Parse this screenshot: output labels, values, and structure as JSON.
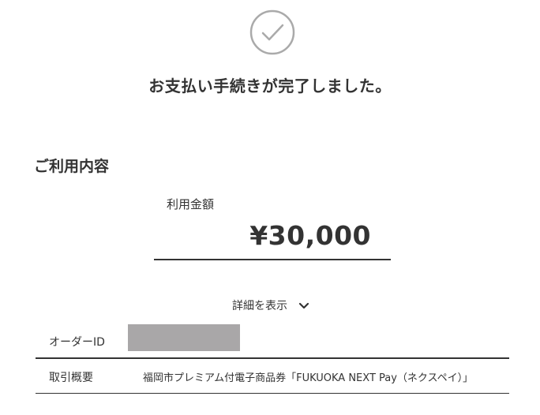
{
  "header": {
    "icon": "check-circle-icon",
    "title": "お支払い手続きが完了しました。"
  },
  "usage": {
    "section_title": "ご利用内容",
    "amount_label": "利用金額",
    "amount_value": "¥30,000",
    "details_toggle_label": "詳細を表示",
    "details_toggle_icon": "chevron-down-icon"
  },
  "details": {
    "rows": [
      {
        "label": "オーダーID",
        "value_redacted": true
      },
      {
        "label": "取引概要",
        "value": "福岡市プレミアム付電子商品券「FUKUOKA NEXT Pay（ネクスペイ）」"
      }
    ]
  },
  "colors": {
    "text": "#333333",
    "icon_stroke": "#aaaaaa",
    "redaction": "#a9a7a8",
    "background": "#ffffff"
  }
}
